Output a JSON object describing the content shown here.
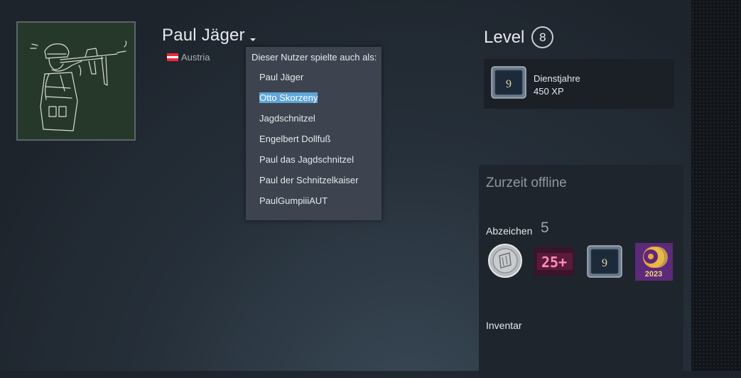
{
  "profile": {
    "name": "Paul Jäger",
    "country": "Austria",
    "avatar_icon": "soldier-sketch-avatar"
  },
  "name_history": {
    "title": "Dieser Nutzer spielte auch als:",
    "aliases": [
      "Paul Jäger",
      "Otto Skorzeny",
      "Jagdschnitzel",
      "Engelbert Dollfuß",
      "Paul das Jagdschnitzel",
      "Paul der Schnitzelkaiser",
      "PaulGumpiiiAUT"
    ],
    "highlighted_index": 1
  },
  "level": {
    "label": "Level",
    "value": "8"
  },
  "featured_badge": {
    "name": "Dienstjahre",
    "xp": "450 XP",
    "icon_number": "9"
  },
  "status": {
    "text": "Zurzeit offline"
  },
  "badges": {
    "label": "Abzeichen",
    "count": "5",
    "items": [
      {
        "icon": "silver-coin-badge-icon"
      },
      {
        "icon": "games-25-plus-badge-icon",
        "text": "25+"
      },
      {
        "icon": "years-of-service-badge-icon",
        "text": "9"
      },
      {
        "icon": "steam-2023-badge-icon",
        "text": "2023"
      }
    ]
  },
  "inventory": {
    "label": "Inventar"
  },
  "colors": {
    "highlight": "#5ea6d8",
    "dropdown_bg": "#3d4450",
    "panel_bg": "#1f252c"
  }
}
